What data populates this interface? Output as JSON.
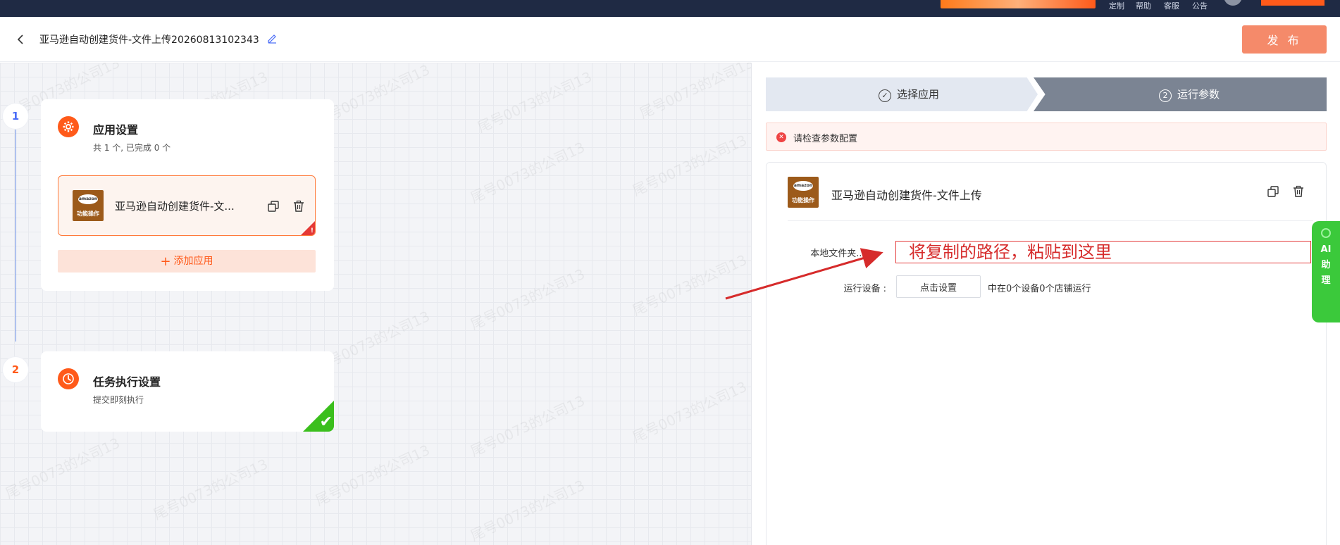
{
  "header": {
    "title": "亚马逊自动创建货件-文件上传20260813102343",
    "publish_label": "发 布"
  },
  "topnav": {
    "links": [
      "定制",
      "帮助",
      "客服",
      "公告"
    ]
  },
  "watermark": "尾号0073的公司13",
  "steps": {
    "step1_number": "1",
    "step2_number": "2"
  },
  "app_settings": {
    "title": "应用设置",
    "subtitle": "共 1 个, 已完成 0 个",
    "app_name": "亚马逊自动创建货件-文...",
    "add_label": "添加应用"
  },
  "task_settings": {
    "title": "任务执行设置",
    "subtitle": "提交即刻执行"
  },
  "logo": {
    "brand": "amazon",
    "caption": "功能操作"
  },
  "panel": {
    "tab1_label": "选择应用",
    "tab2_number": "2",
    "tab2_label": "运行参数",
    "alert_text": "请检查参数配置",
    "app_name": "亚马逊自动创建货件-文件上传",
    "folder_label": "本地文件夹...",
    "folder_colon": ":",
    "folder_value": "将复制的路径，粘贴到这里",
    "device_label": "运行设备 :",
    "device_button": "点击设置",
    "device_hint": "中在0个设备0个店铺运行"
  },
  "ai_helper": {
    "label": "AI助理"
  },
  "colors": {
    "accent": "#ff5a1a",
    "publish": "#f58a6a",
    "nav_bg": "#1f2a44",
    "error": "#e53935",
    "success": "#3bbf1d",
    "ai_green": "#3bc93b"
  }
}
